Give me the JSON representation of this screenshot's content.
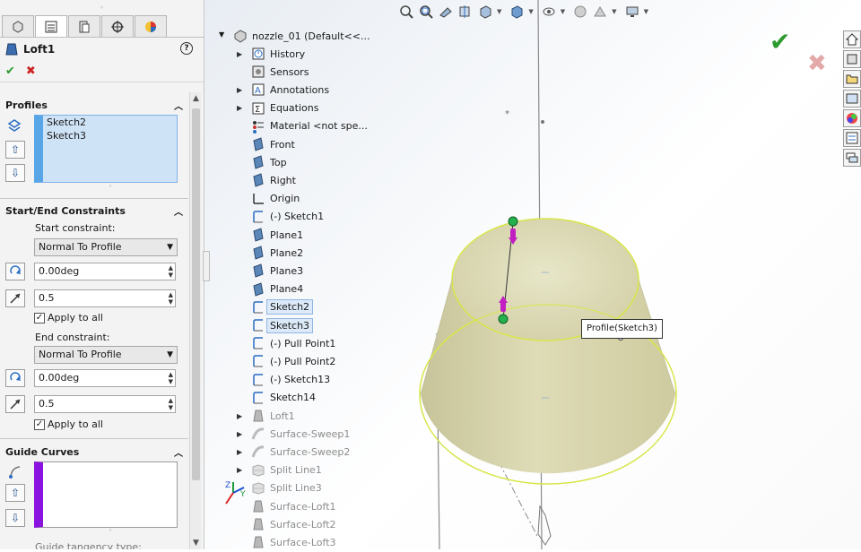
{
  "property_manager": {
    "feature_title": "Loft1",
    "help_label": "?",
    "ok_label": "✔",
    "cancel_label": "✖",
    "profiles": {
      "header": "Profiles",
      "items": [
        "Sketch2",
        "Sketch3"
      ],
      "up_label": "⇧",
      "down_label": "⇩"
    },
    "constraints": {
      "header": "Start/End Constraints",
      "start_label": "Start constraint:",
      "start_value": "Normal To Profile",
      "start_angle": "0.00deg",
      "start_length": "0.5",
      "start_apply_all": "Apply to all",
      "end_label": "End constraint:",
      "end_value": "Normal To Profile",
      "end_angle": "0.00deg",
      "end_length": "0.5",
      "end_apply_all": "Apply to all"
    },
    "guide_curves": {
      "header": "Guide Curves",
      "tangency_label": "Guide tangency type:"
    }
  },
  "tree": {
    "root": "nozzle_01  (Default<<...",
    "items": [
      {
        "label": "History",
        "expandable": true,
        "icon": "history-icon"
      },
      {
        "label": "Sensors",
        "expandable": false,
        "icon": "sensor-icon"
      },
      {
        "label": "Annotations",
        "expandable": true,
        "icon": "annotation-icon"
      },
      {
        "label": "Equations",
        "expandable": true,
        "icon": "equation-icon"
      },
      {
        "label": "Material <not spe...",
        "expandable": false,
        "icon": "material-icon"
      },
      {
        "label": "Front",
        "expandable": false,
        "icon": "plane-icon"
      },
      {
        "label": "Top",
        "expandable": false,
        "icon": "plane-icon"
      },
      {
        "label": "Right",
        "expandable": false,
        "icon": "plane-icon"
      },
      {
        "label": "Origin",
        "expandable": false,
        "icon": "origin-icon"
      },
      {
        "label": "(-) Sketch1",
        "expandable": false,
        "icon": "sketch-icon"
      },
      {
        "label": "Plane1",
        "expandable": false,
        "icon": "plane-icon"
      },
      {
        "label": "Plane2",
        "expandable": false,
        "icon": "plane-icon"
      },
      {
        "label": "Plane3",
        "expandable": false,
        "icon": "plane-icon"
      },
      {
        "label": "Plane4",
        "expandable": false,
        "icon": "plane-icon"
      },
      {
        "label": "Sketch2",
        "expandable": false,
        "icon": "sketch-icon",
        "selected": true
      },
      {
        "label": "Sketch3",
        "expandable": false,
        "icon": "sketch-icon",
        "selected": true
      },
      {
        "label": "(-) Pull Point1",
        "expandable": false,
        "icon": "sketch-icon"
      },
      {
        "label": "(-) Pull Point2",
        "expandable": false,
        "icon": "sketch-icon"
      },
      {
        "label": "(-) Sketch13",
        "expandable": false,
        "icon": "sketch-icon"
      },
      {
        "label": "Sketch14",
        "expandable": false,
        "icon": "sketch-icon"
      },
      {
        "label": "Loft1",
        "expandable": true,
        "icon": "loft-icon",
        "gray": true
      },
      {
        "label": "Surface-Sweep1",
        "expandable": true,
        "icon": "sweep-icon",
        "gray": true
      },
      {
        "label": "Surface-Sweep2",
        "expandable": true,
        "icon": "sweep-icon",
        "gray": true
      },
      {
        "label": "Split Line1",
        "expandable": true,
        "icon": "split-line-icon",
        "gray": true
      },
      {
        "label": "Split Line3",
        "expandable": false,
        "icon": "split-line-icon",
        "gray": true
      },
      {
        "label": "Surface-Loft1",
        "expandable": false,
        "icon": "loft-icon",
        "gray": true
      },
      {
        "label": "Surface-Loft2",
        "expandable": false,
        "icon": "loft-icon",
        "gray": true
      },
      {
        "label": "Surface-Loft3",
        "expandable": false,
        "icon": "loft-icon",
        "gray": true
      }
    ]
  },
  "viewport": {
    "tooltip": "Profile(Sketch3)",
    "accent_yellow": "#d8e64a",
    "connector_green": "#22b14c",
    "handle_magenta": "#c21fc2"
  }
}
